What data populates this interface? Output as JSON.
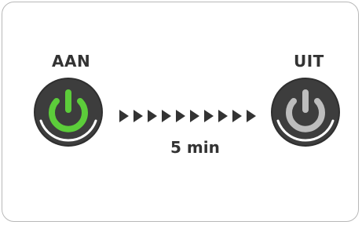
{
  "panel": {
    "on_label": "AAN",
    "off_label": "UIT",
    "duration": "5 min"
  },
  "buttons": {
    "on": {
      "icon": "power-icon",
      "state": "on",
      "color": "#5ccd3a"
    },
    "off": {
      "icon": "power-icon",
      "state": "off",
      "color": "#bdbdbd"
    }
  },
  "colors": {
    "button_body": "#3d3d3d",
    "arrow": "#333333",
    "text": "#333333"
  }
}
